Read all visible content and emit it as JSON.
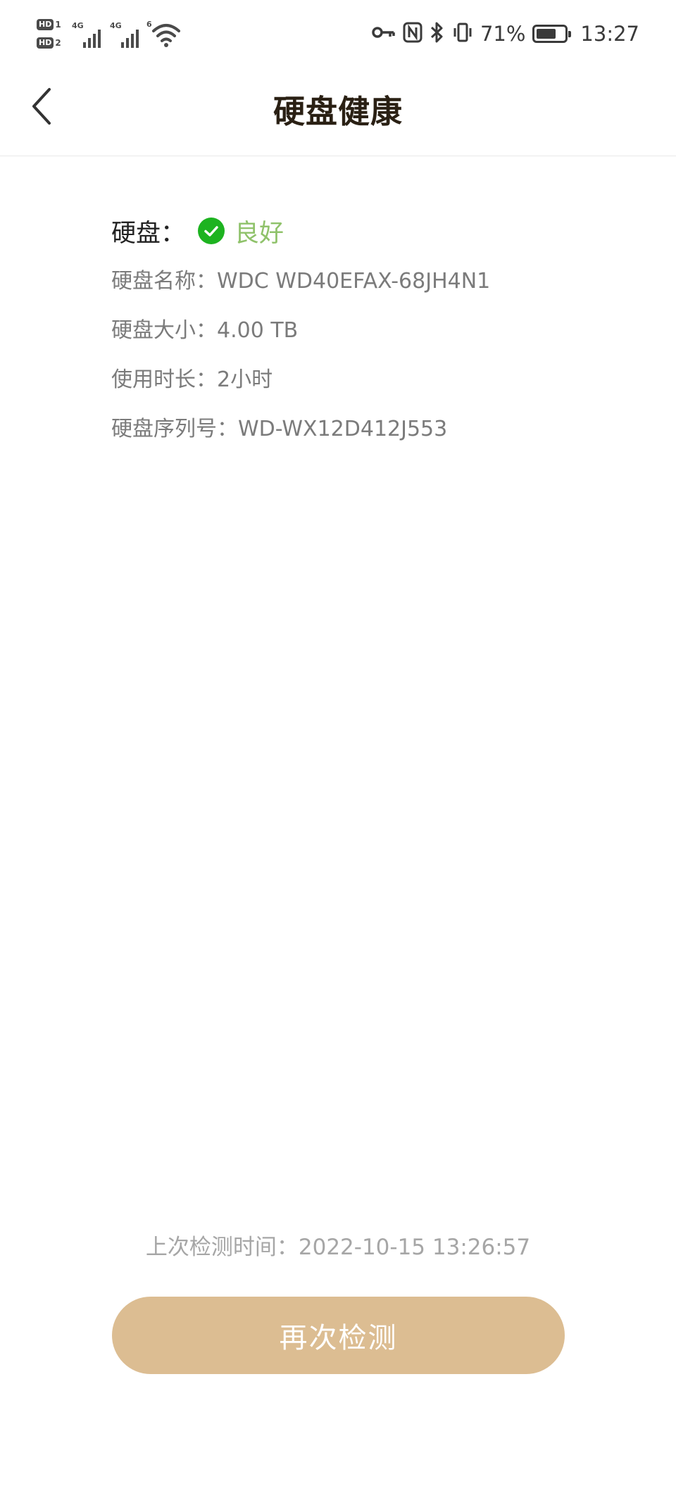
{
  "status_bar": {
    "sim1_badge": "HD",
    "sim1_number": "1",
    "sim2_badge": "HD",
    "sim2_number": "2",
    "network1": "4G",
    "network2": "4G",
    "wifi_gen": "6",
    "battery_percent": "71%",
    "battery_level": 0.71,
    "time": "13:27"
  },
  "header": {
    "title": "硬盘健康"
  },
  "disk": {
    "status_label": "硬盘：",
    "status_value": "良好",
    "status_color": "#8fc26a",
    "check_color": "#1db320",
    "name_label": "硬盘名称：",
    "name_value": "WDC WD40EFAX-68JH4N1",
    "size_label": "硬盘大小：",
    "size_value": "4.00 TB",
    "usage_label": "使用时长：",
    "usage_value": "2小时",
    "serial_label": "硬盘序列号：",
    "serial_value": "WD-WX12D412J553"
  },
  "footer": {
    "last_check_label": "上次检测时间：",
    "last_check_value": "2022-10-15 13:26:57",
    "recheck_button": "再次检测",
    "button_color": "#dcbd92"
  },
  "icons": {
    "back": "chevron-left-icon",
    "status": "check-circle-icon",
    "key": "key-icon",
    "nfc": "nfc-icon",
    "bluetooth": "bluetooth-icon",
    "vibrate": "vibrate-icon",
    "wifi": "wifi-icon",
    "signal": "signal-icon",
    "battery": "battery-icon"
  }
}
